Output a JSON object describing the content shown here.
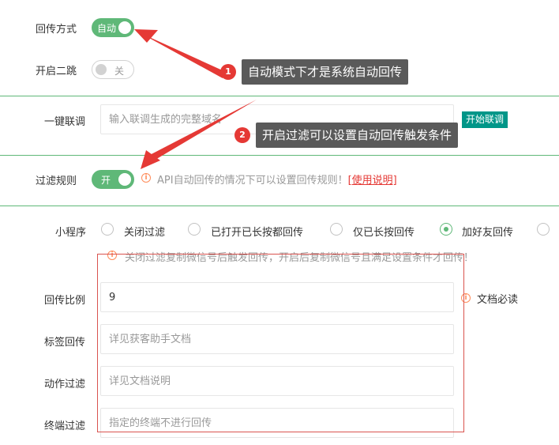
{
  "return_mode": {
    "label": "回传方式",
    "toggle_text": "自动"
  },
  "open_two_jump": {
    "label": "开启二跳",
    "toggle_text": "关"
  },
  "annotations": [
    {
      "number": "1",
      "text": "自动模式下才是系统自动回传"
    },
    {
      "number": "2",
      "text": "开启过滤可以设置自动回传触发条件"
    }
  ],
  "one_click": {
    "label": "一键联调",
    "placeholder": "输入联调生成的完整域名",
    "button": "开始联调"
  },
  "filter_rule": {
    "label": "过滤规则",
    "toggle_text": "开",
    "hint": "API自动回传的情况下可以设置回传规则！",
    "link": "[使用说明]"
  },
  "mini_program": {
    "label": "小程序",
    "options": [
      "关闭过滤",
      "已打开已长按都回传",
      "仅已长按回传",
      "加好友回传"
    ],
    "selected_index": 3,
    "hint": "关闭过滤复制微信号后触发回传，开启后复制微信号且满足设置条件才回传！"
  },
  "ratio": {
    "label": "回传比例",
    "value": "9",
    "doc": "文档必读"
  },
  "tag_return": {
    "label": "标签回传",
    "placeholder": "详见获客助手文档"
  },
  "action_filter": {
    "label": "动作过滤",
    "placeholder": "详见文档说明"
  },
  "terminal_filter": {
    "label": "终端过滤",
    "placeholder": "指定的终端不进行回传"
  },
  "colors": {
    "accent": "#5fb878",
    "teal": "#009688",
    "warn": "#ff8c5a",
    "annotation_red": "#e53935"
  }
}
